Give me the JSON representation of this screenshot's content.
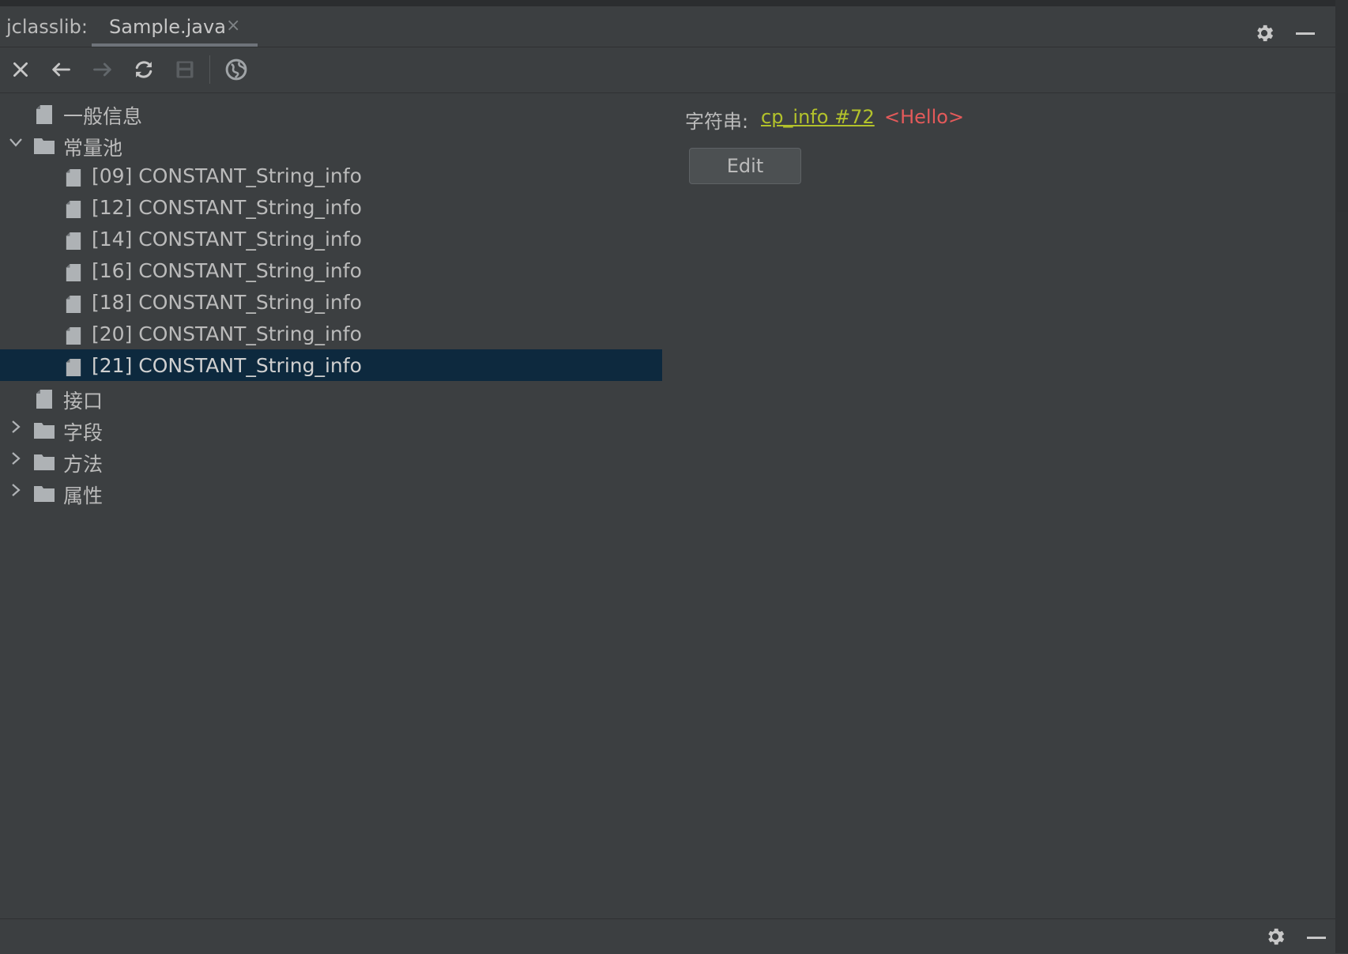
{
  "app": {
    "label": "jclasslib:"
  },
  "tab": {
    "title": "Sample.java",
    "close_glyph": "×"
  },
  "toolbar": {
    "buttons": [
      "close-icon",
      "back-arrow-icon",
      "forward-arrow-icon",
      "refresh-icon",
      "save-icon",
      "web-icon"
    ]
  },
  "tree": {
    "items": [
      {
        "label": "一般信息",
        "type": "file",
        "expandable": false
      },
      {
        "label": "常量池",
        "type": "folder",
        "expanded": true
      },
      {
        "label": "[09] CONSTANT_String_info",
        "type": "file"
      },
      {
        "label": "[12] CONSTANT_String_info",
        "type": "file"
      },
      {
        "label": "[14] CONSTANT_String_info",
        "type": "file"
      },
      {
        "label": "[16] CONSTANT_String_info",
        "type": "file"
      },
      {
        "label": "[18] CONSTANT_String_info",
        "type": "file"
      },
      {
        "label": "[20] CONSTANT_String_info",
        "type": "file"
      },
      {
        "label": "[21] CONSTANT_String_info",
        "type": "file",
        "selected": true
      },
      {
        "label": "接口",
        "type": "file"
      },
      {
        "label": "字段",
        "type": "folder",
        "expanded": false
      },
      {
        "label": "方法",
        "type": "folder",
        "expanded": false
      },
      {
        "label": "属性",
        "type": "folder",
        "expanded": false
      }
    ]
  },
  "detail": {
    "label": "字符串:",
    "link": "cp_info #72",
    "value": "<Hello>",
    "edit_button": "Edit"
  },
  "colors": {
    "background": "#3c3f41",
    "selection": "#0d293e",
    "link": "#b3c22b",
    "value": "#e45a5a"
  }
}
